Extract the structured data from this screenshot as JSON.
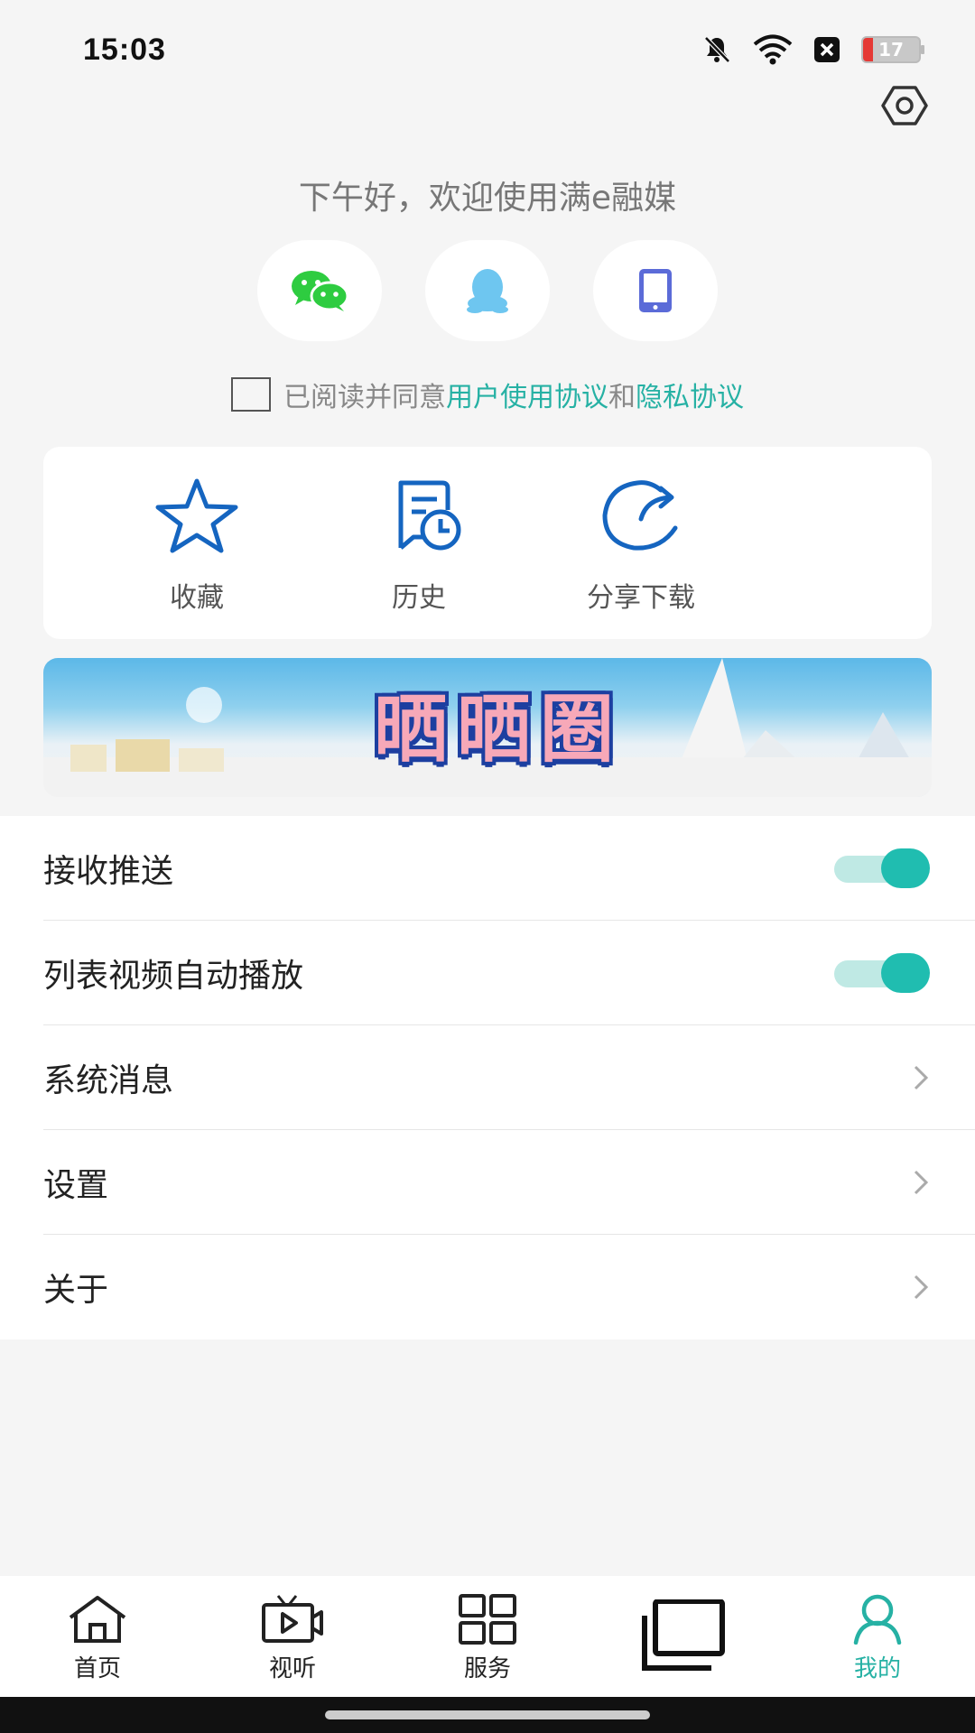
{
  "status_bar": {
    "time": "15:03",
    "battery": "17"
  },
  "greeting": "下午好，欢迎使用满e融媒",
  "login_options": [
    "wechat-icon",
    "qq-icon",
    "phone-icon"
  ],
  "agreement": {
    "prefix": "已阅读并同意",
    "terms": "用户使用协议",
    "conj": "和",
    "privacy": "隐私协议"
  },
  "quick_actions": [
    {
      "label": "收藏",
      "icon": "star-icon"
    },
    {
      "label": "历史",
      "icon": "history-icon"
    },
    {
      "label": "分享下载",
      "icon": "share-icon"
    }
  ],
  "banner": {
    "title": "晒晒圈"
  },
  "menu": {
    "push": "接收推送",
    "autoplay": "列表视频自动播放",
    "messages": "系统消息",
    "settings": "设置",
    "about": "关于"
  },
  "toggles": {
    "push": true,
    "autoplay": true
  },
  "tabs": [
    {
      "label": "首页",
      "icon": "home-icon"
    },
    {
      "label": "视听",
      "icon": "tv-icon"
    },
    {
      "label": "服务",
      "icon": "grid-icon"
    },
    {
      "label": "",
      "icon": "windows-icon"
    },
    {
      "label": "我的",
      "icon": "person-icon"
    }
  ],
  "colors": {
    "accent": "#26b1a4",
    "icon_blue": "#1565c0",
    "wechat": "#2ecc40",
    "qq": "#6ec6f0",
    "phone": "#5b6bd8"
  }
}
